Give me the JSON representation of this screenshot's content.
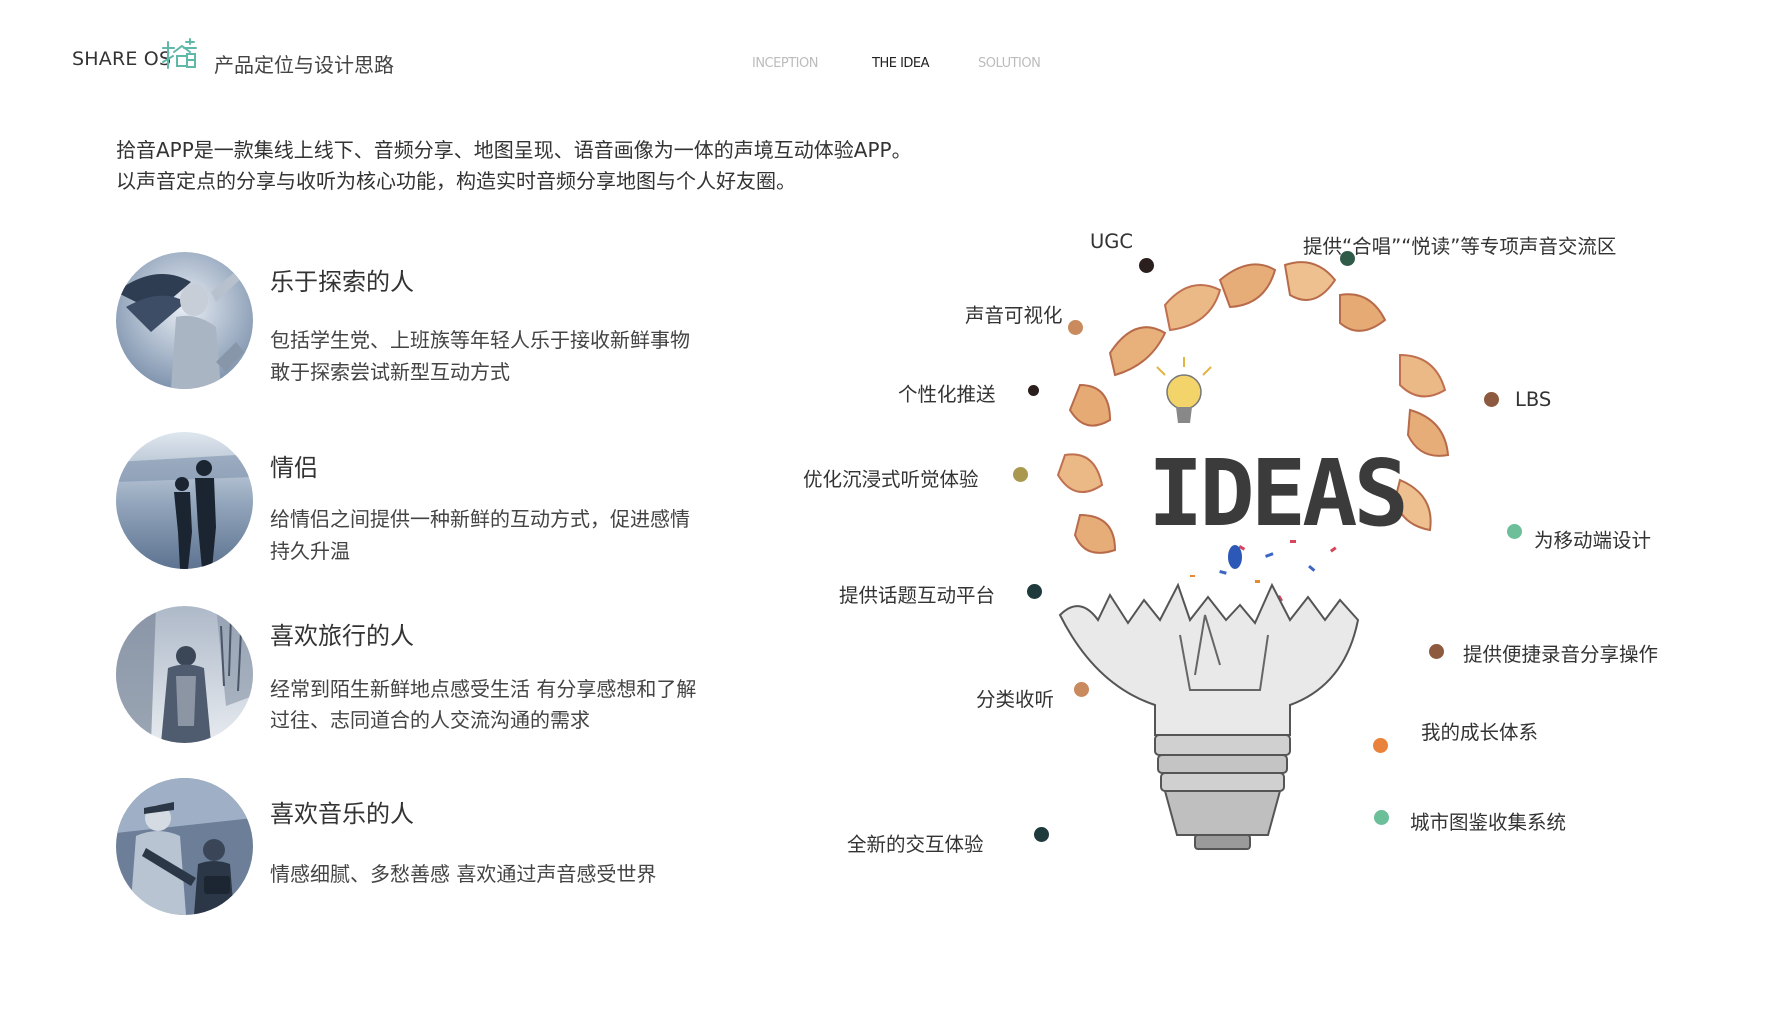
{
  "header": {
    "brand": "SHARE OS",
    "logo_icon": "shiyin-logo-icon",
    "title": "产品定位与设计思路",
    "nav": [
      {
        "label": "INCEPTION",
        "active": false
      },
      {
        "label": "THE IDEA",
        "active": true
      },
      {
        "label": "SOLUTION",
        "active": false
      }
    ]
  },
  "intro": [
    "拾音APP是一款集线上线下、音频分享、地图呈现、语音画像为一体的声境互动体验APP。",
    "以声音定点的分享与收听为核心功能，构造实时音频分享地图与个人好友圈。"
  ],
  "personas": [
    {
      "title": "乐于探索的人",
      "lines": [
        "包括学生党、上班族等年轻人乐于接收新鲜事物",
        "敢于探索尝试新型互动方式"
      ],
      "image": "dancer-photo"
    },
    {
      "title": "情侣",
      "lines": [
        "给情侣之间提供一种新鲜的互动方式，促进感情",
        "持久升温"
      ],
      "image": "couple-beach-photo"
    },
    {
      "title": "喜欢旅行的人",
      "lines": [
        "经常到陌生新鲜地点感受生活 有分享感想和了解",
        "过往、志同道合的人交流沟通的需求"
      ],
      "image": "traveler-snow-photo"
    },
    {
      "title": "喜欢音乐的人",
      "lines": [
        "情感细腻、多愁善感 喜欢通过声音感受世界"
      ],
      "image": "musicians-street-photo"
    }
  ],
  "idea_word": "IDEAS",
  "features": [
    {
      "label": "UGC",
      "color": "#2a1f1c"
    },
    {
      "label": "提供“合唱”“悦读”等专项声音交流区",
      "color": "#2f5b48"
    },
    {
      "label": "声音可视化",
      "color": "#c98a5e"
    },
    {
      "label": "个性化推送",
      "color": "#2a1f1c"
    },
    {
      "label": "LBS",
      "color": "#8e5a3f"
    },
    {
      "label": "优化沉浸式听觉体验",
      "color": "#a8994f"
    },
    {
      "label": "为移动端设计",
      "color": "#6cbf98"
    },
    {
      "label": "提供话题互动平台",
      "color": "#1f3a3c"
    },
    {
      "label": "提供便捷录音分享操作",
      "color": "#8e5a3f"
    },
    {
      "label": "分类收听",
      "color": "#c98a5e"
    },
    {
      "label": "我的成长体系",
      "color": "#e9823a"
    },
    {
      "label": "城市图鉴收集系统",
      "color": "#6cbf98"
    },
    {
      "label": "全新的交互体验",
      "color": "#1f3a3c"
    }
  ]
}
